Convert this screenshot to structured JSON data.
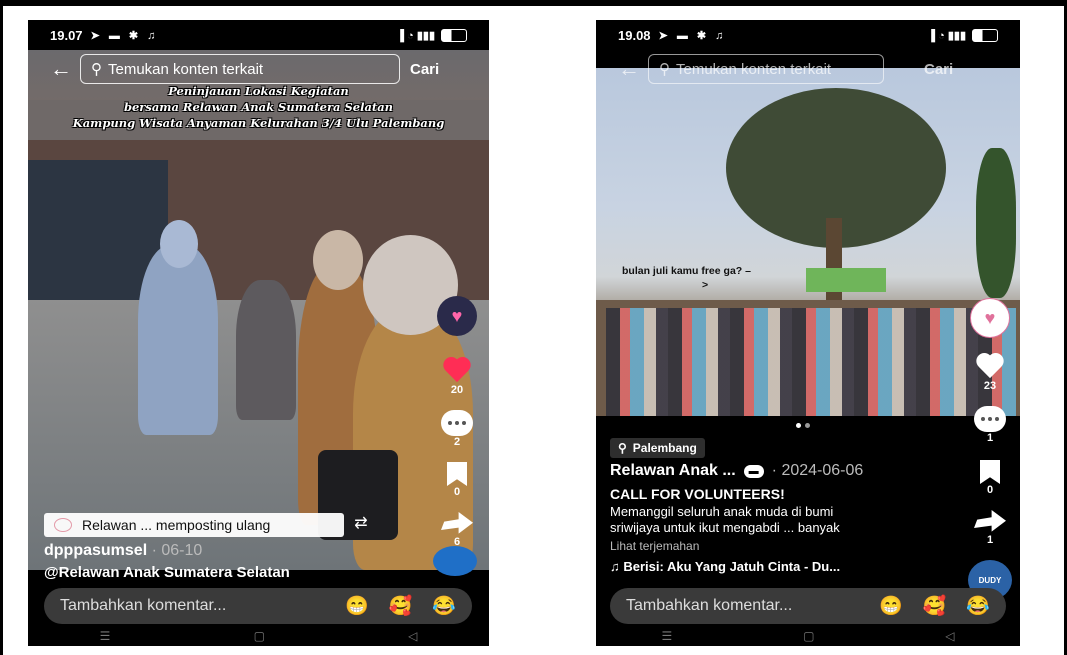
{
  "left_screen": {
    "status": {
      "time": "19.07",
      "battery": "3"
    },
    "search": {
      "placeholder": "Temukan konten terkait",
      "button": "Cari"
    },
    "banner": [
      "Peninjauan Lokasi Kegiatan",
      "bersama Relawan Anak Sumatera Selatan",
      "Kampung Wisata Anyaman Kelurahan 3/4 Ulu Palembang"
    ],
    "actions": {
      "likes": "20",
      "comments": "2",
      "saves": "0",
      "shares": "6"
    },
    "repost": {
      "label": "Relawan ... memposting ulang"
    },
    "author": {
      "name": "dpppasumsel",
      "date": " · 06-10"
    },
    "caption": "@Relawan Anak Sumatera Selatan",
    "comment": {
      "placeholder": "Tambahkan komentar...",
      "emojis": [
        "😁",
        "🥰",
        "😂"
      ]
    }
  },
  "right_screen": {
    "status": {
      "time": "19.08",
      "battery": "2"
    },
    "search": {
      "placeholder": "Temukan konten terkait",
      "button": "Cari"
    },
    "overlay_text": [
      "bulan juli kamu free ga? –",
      ">"
    ],
    "actions": {
      "likes": "23",
      "comments": "1",
      "saves": "0",
      "shares": "1"
    },
    "location": "Palembang",
    "author": {
      "name": "Relawan Anak ...",
      "date": "· 2024-06-06"
    },
    "headline": "CALL FOR VOLUNTEERS!",
    "body": [
      "Memanggil seluruh anak muda di bumi",
      "sriwijaya untuk ikut mengabdi ...   banyak"
    ],
    "translate": "Lihat terjemahan",
    "music": "♫ Berisi: Aku Yang Jatuh Cinta - Du...",
    "music_avatar": "DUDY",
    "comment": {
      "placeholder": "Tambahkan komentar...",
      "emojis": [
        "😁",
        "🥰",
        "😂"
      ]
    }
  }
}
